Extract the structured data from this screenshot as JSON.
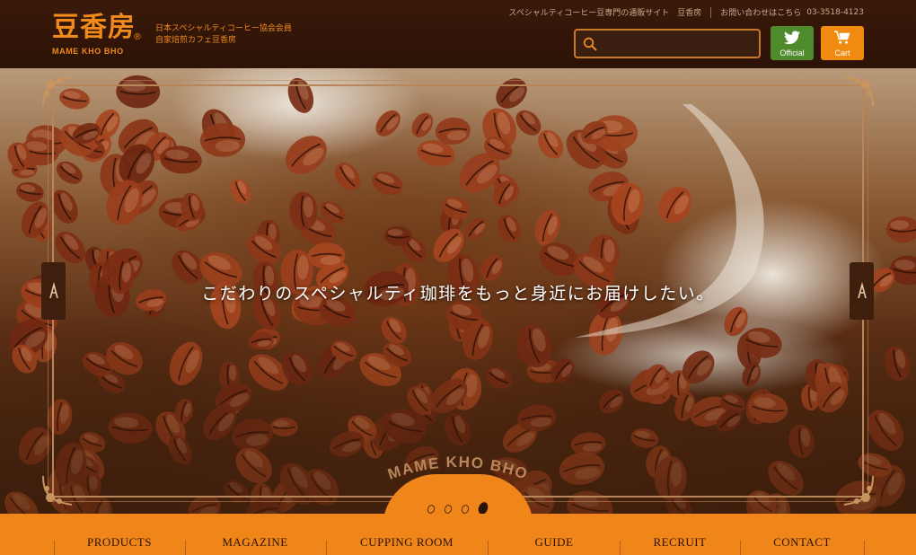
{
  "header": {
    "logo_text": "豆香房",
    "logo_reg": "®",
    "logo_sub": "MAME KHO BHO",
    "tagline_line1": "日本スペシャルティコーヒー協会会員",
    "tagline_line2": "自家焙煎カフェ豆香房",
    "site_link": "スペシャルティコーヒー豆専門の通販サイト　豆香房",
    "contact_link": "お問い合わせはこちら",
    "phone": "03-3518-4123",
    "search": {
      "placeholder": "",
      "value": ""
    },
    "official_label": "Official",
    "cart_label": "Cart"
  },
  "hero": {
    "copy": "こだわりのスペシャルティ珈琲をもっと身近にお届けしたい。",
    "arc_text": "MAME KHO BHO",
    "prev_icon": "chevron-left-icon",
    "next_icon": "chevron-right-icon",
    "slides_total": 4,
    "slide_active": 4
  },
  "nav": {
    "items": [
      {
        "label": "PRODUCTS"
      },
      {
        "label": "MAGAZINE"
      },
      {
        "label": "CUPPING ROOM"
      },
      {
        "label": "GUIDE"
      },
      {
        "label": "RECRUIT"
      },
      {
        "label": "CONTACT"
      }
    ]
  },
  "colors": {
    "header_bg": "#2c1207",
    "accent": "#f0861a",
    "official_green": "#4f8a2c",
    "nav_text": "#2b1208"
  }
}
